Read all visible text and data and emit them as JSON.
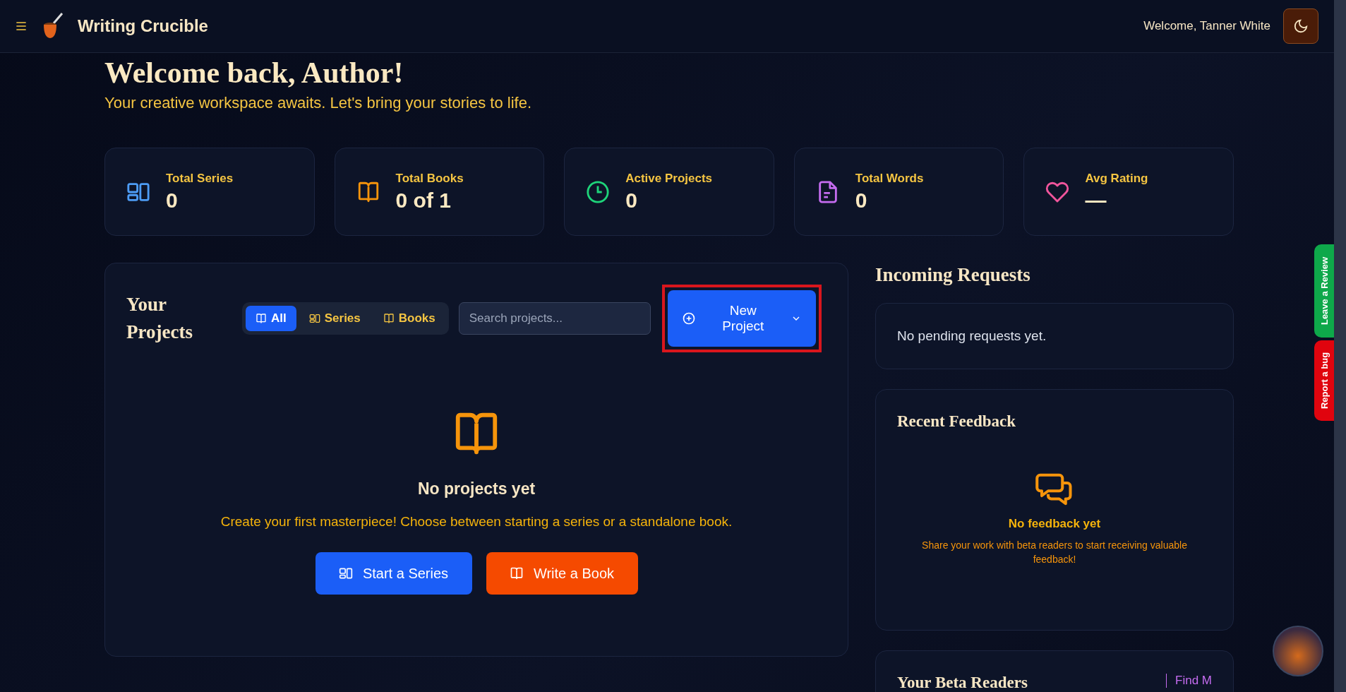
{
  "topbar": {
    "brand": "Writing Crucible",
    "welcome": "Welcome, Tanner White"
  },
  "hero": {
    "title": "Welcome back, Author!",
    "subtitle": "Your creative workspace awaits. Let's bring your stories to life."
  },
  "stats": [
    {
      "kind": "series",
      "label": "Total Series",
      "value": "0"
    },
    {
      "kind": "books",
      "label": "Total Books",
      "value": "0 of 1"
    },
    {
      "kind": "active",
      "label": "Active Projects",
      "value": "0"
    },
    {
      "kind": "words",
      "label": "Total Words",
      "value": "0"
    },
    {
      "kind": "rating",
      "label": "Avg Rating",
      "value": "—"
    }
  ],
  "projects": {
    "title": "Your Projects",
    "filters": [
      {
        "kind": "book",
        "label": "All",
        "selected": true
      },
      {
        "kind": "series",
        "label": "Series",
        "selected": false
      },
      {
        "kind": "book",
        "label": "Books",
        "selected": false
      }
    ],
    "search": {
      "placeholder": "Search projects..."
    },
    "new_button": "New Project",
    "highlighted": true,
    "empty": {
      "title": "No projects yet",
      "text": "Create your first masterpiece! Choose between starting a series or a standalone book."
    },
    "actions": [
      {
        "kind": "series",
        "label": "Start a Series"
      },
      {
        "kind": "book",
        "label": "Write a Book"
      }
    ]
  },
  "requests": {
    "title": "Incoming Requests",
    "empty": "No pending requests yet."
  },
  "feedback": {
    "title": "Recent Feedback",
    "empty_title": "No feedback yet",
    "empty_text": "Share your work with beta readers to start receiving valuable feedback!"
  },
  "beta": {
    "title": "Your Beta Readers",
    "link": "Find M"
  },
  "side_tabs": [
    {
      "label": "Leave a Review",
      "color": "#0ea84a"
    },
    {
      "label": "Report a bug",
      "color": "#e0040e"
    }
  ]
}
